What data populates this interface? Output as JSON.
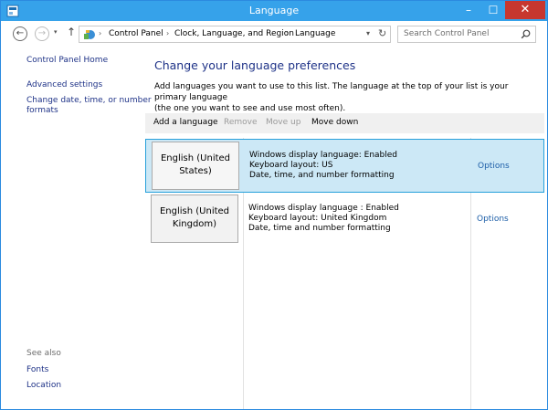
{
  "window": {
    "title": "Language",
    "accent": "#36a2ea"
  },
  "titlebar": {
    "minimize": "–",
    "maximize": "☐",
    "close": "✕"
  },
  "nav": {
    "back": "←",
    "forward": "→",
    "recent": "▾",
    "up": "↑",
    "breadcrumbs": [
      "Control Panel",
      "Clock, Language, and Region",
      "Language"
    ],
    "separator": "›",
    "dropdown": "▾",
    "refresh": "↻"
  },
  "search": {
    "placeholder": "Search Control Panel"
  },
  "sidebar": {
    "home": "Control Panel Home",
    "links": [
      "Advanced settings",
      "Change date, time, or number",
      "formats"
    ],
    "see_also": "See also",
    "see_also_links": [
      "Fonts",
      "Location"
    ]
  },
  "main": {
    "heading": "Change your language preferences",
    "description_line1": "Add languages you want to use to this list. The language at the top of your list is your primary language",
    "description_line2": "(the one you want to see and use most often).",
    "toolbar": {
      "add": "Add a language",
      "remove": "Remove",
      "move_up": "Move up",
      "move_down": "Move down"
    },
    "languages": [
      {
        "name_line1": "English (United",
        "name_line2": "States)",
        "display": "Windows display language: Enabled",
        "keyboard": "Keyboard layout: US",
        "formatting": "Date, time, and number formatting",
        "options": "Options"
      },
      {
        "name_line1": "English (United",
        "name_line2": "Kingdom)",
        "display": "Windows display language : Enabled",
        "keyboard": "Keyboard layout: United Kingdom",
        "formatting": "Date, time and number formatting",
        "options": "Options"
      }
    ]
  }
}
